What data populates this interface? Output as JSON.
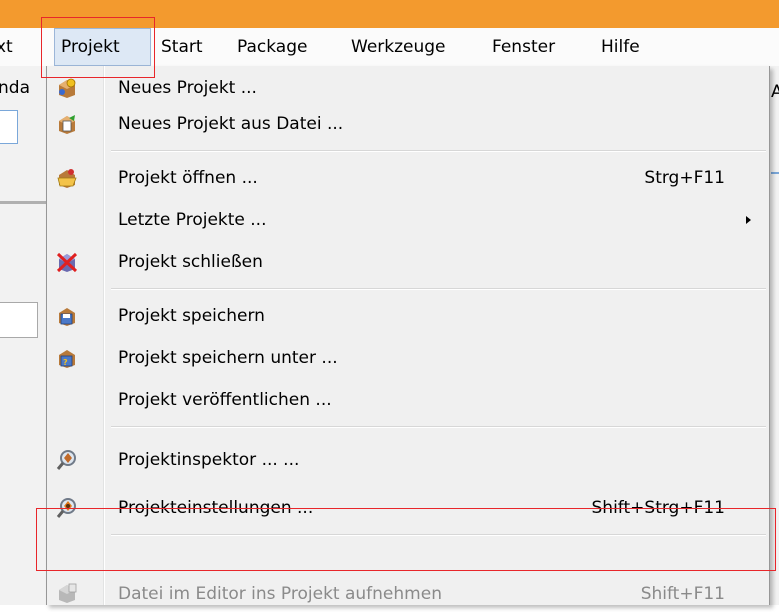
{
  "menubar": {
    "items": [
      {
        "label": "xt"
      },
      {
        "label": "Projekt"
      },
      {
        "label": "Start"
      },
      {
        "label": "Package"
      },
      {
        "label": "Werkzeuge"
      },
      {
        "label": "Fenster"
      },
      {
        "label": "Hilfe"
      }
    ]
  },
  "background": {
    "left_fragment": "nda",
    "right_fragment": "A"
  },
  "menu": {
    "items": [
      {
        "label": "Neues Projekt ...",
        "shortcut": "",
        "icon": "new-project-icon"
      },
      {
        "label": "Neues Projekt aus Datei ...",
        "shortcut": "",
        "icon": "new-project-from-file-icon"
      },
      {
        "label": "Projekt öffnen ...",
        "shortcut": "Strg+F11",
        "icon": "open-project-icon"
      },
      {
        "label": "Letzte Projekte ...",
        "shortcut": "",
        "icon": ""
      },
      {
        "label": "Projekt schließen",
        "shortcut": "",
        "icon": "close-project-icon"
      },
      {
        "label": "Projekt speichern",
        "shortcut": "",
        "icon": "save-project-icon"
      },
      {
        "label": "Projekt speichern unter ...",
        "shortcut": "",
        "icon": "save-project-as-icon"
      },
      {
        "label": "Projekt veröffentlichen ...",
        "shortcut": "",
        "icon": ""
      },
      {
        "label": "Projektinspektor ... ...",
        "shortcut": "",
        "icon": "project-inspector-icon"
      },
      {
        "label": "Projekteinstellungen ...",
        "shortcut": "Shift+Strg+F11",
        "icon": "project-settings-icon"
      },
      {
        "label": "Datei im Editor ins Projekt aufnehmen",
        "shortcut": "Shift+F11",
        "icon": "add-file-to-project-icon",
        "disabled": true
      }
    ]
  },
  "colors": {
    "title_bar": "#f39a2e",
    "highlight_box": "#e8262a",
    "menu_bg": "#f0f0f0"
  }
}
